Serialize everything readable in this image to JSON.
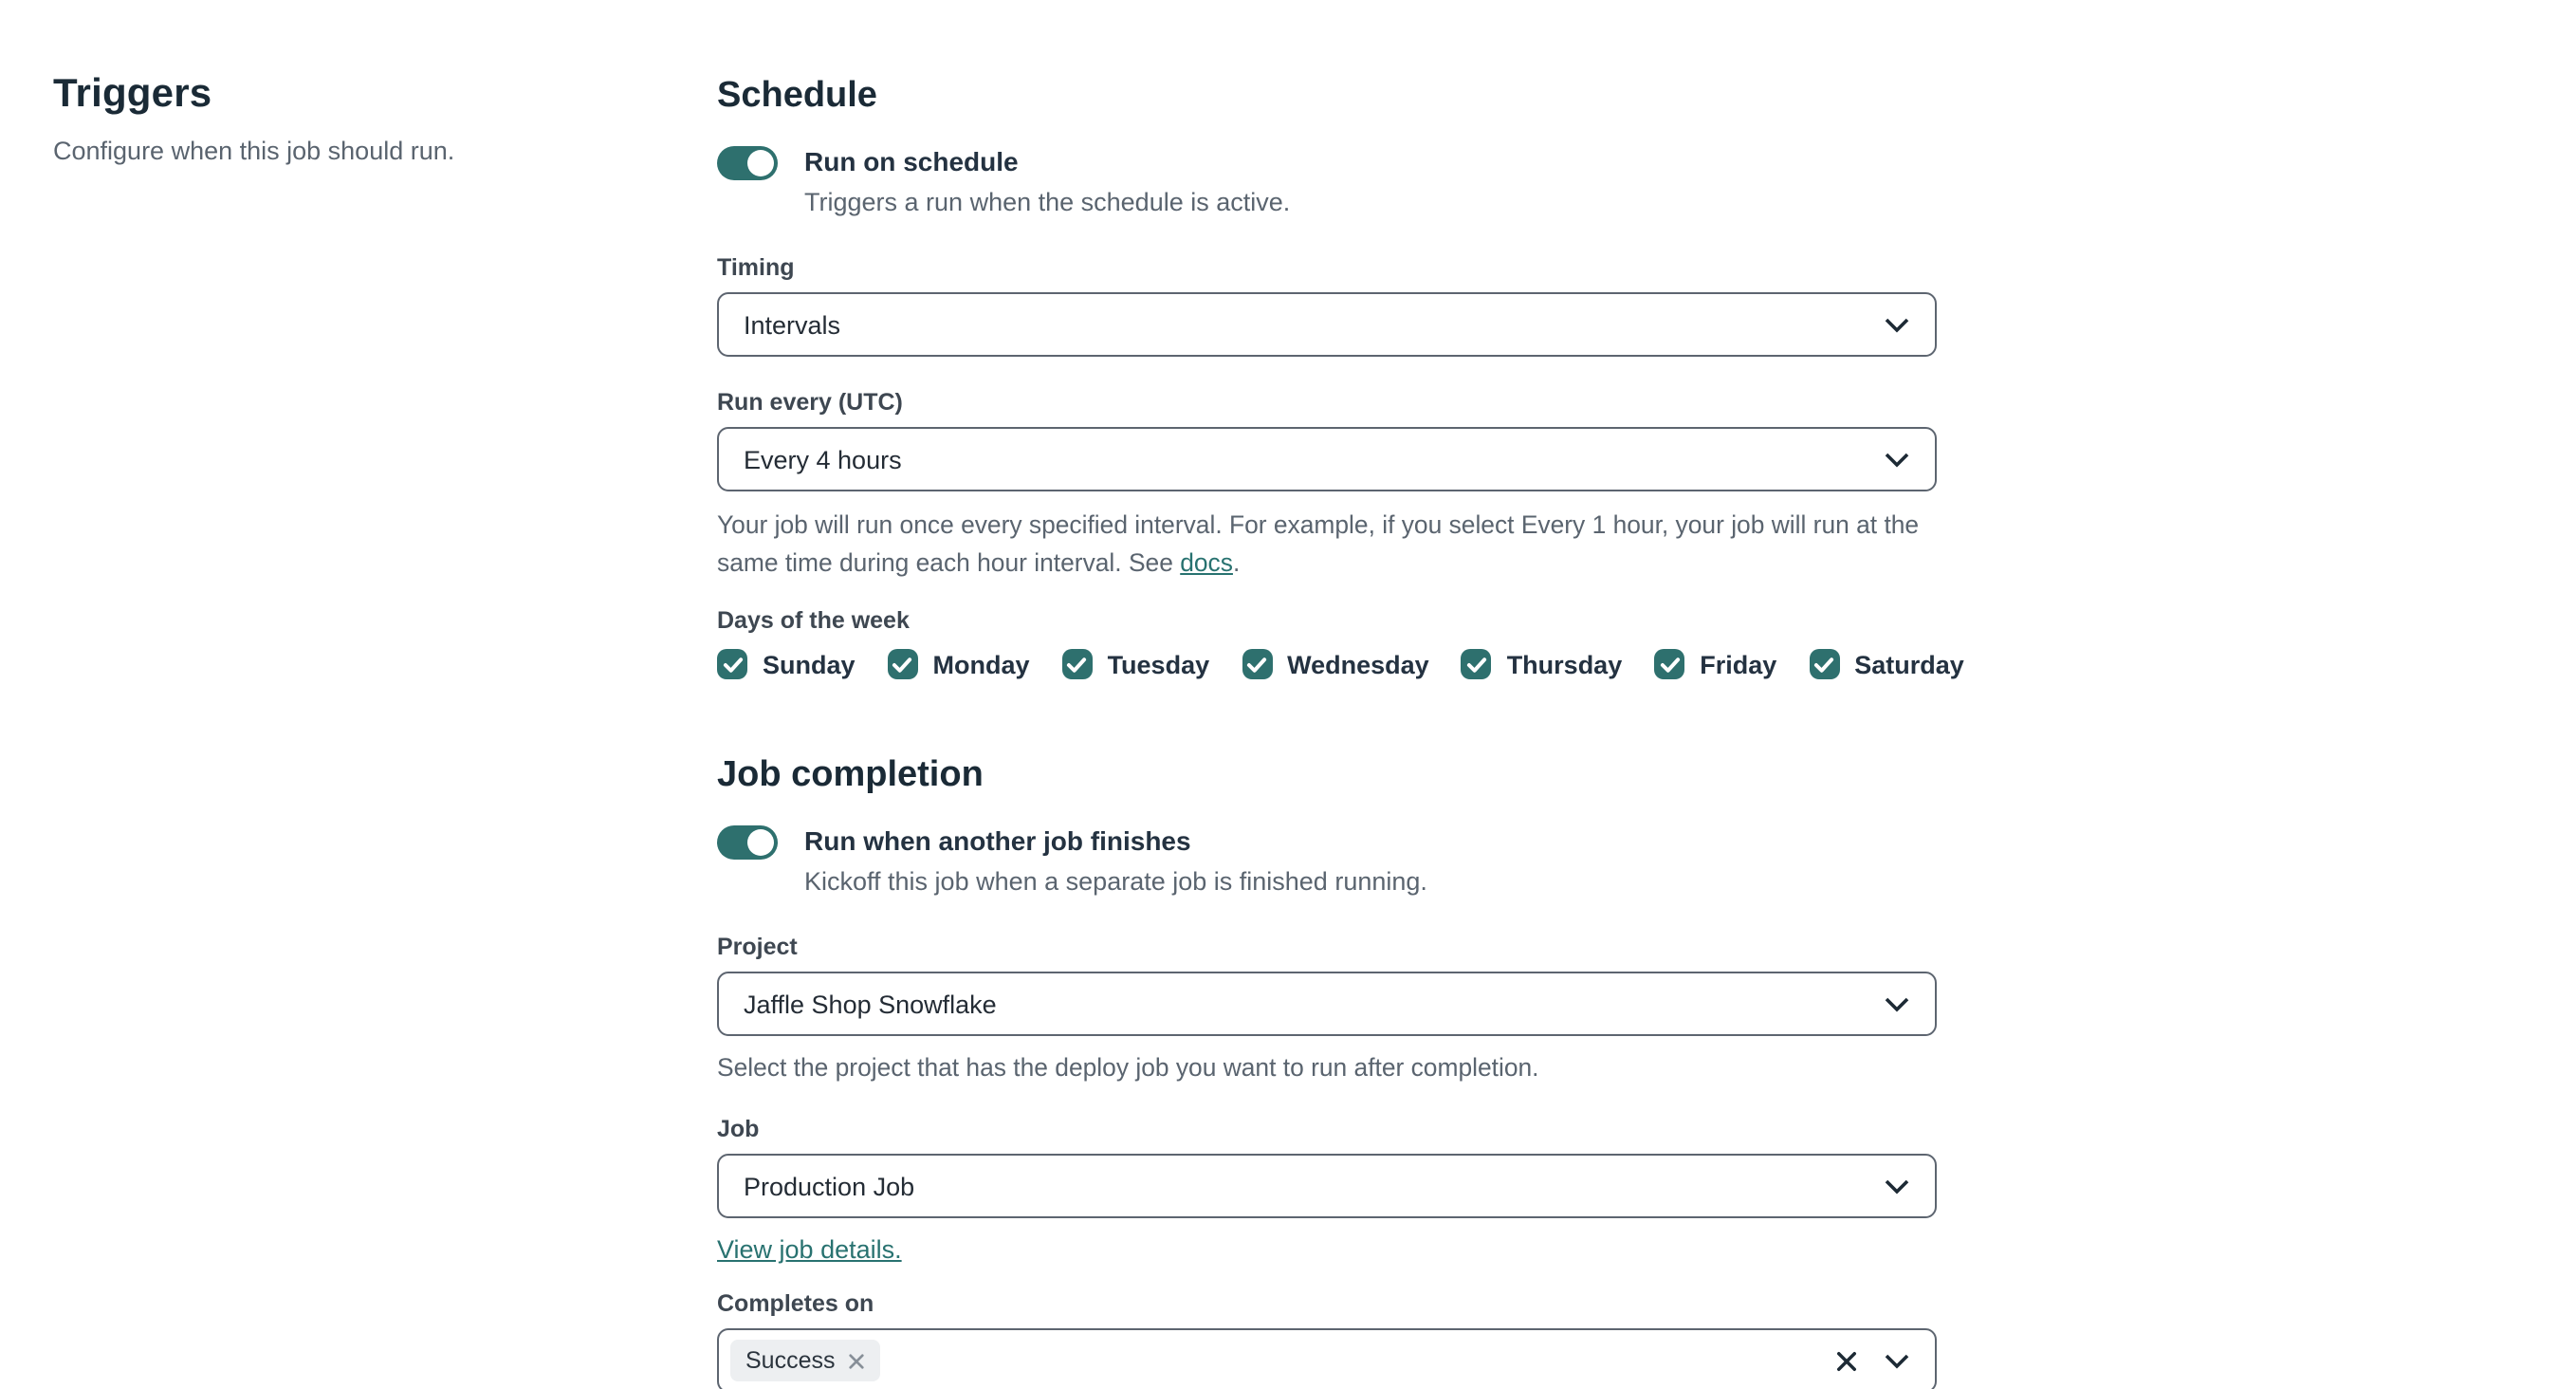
{
  "header": {
    "title": "Triggers",
    "subtitle": "Configure when this job should run."
  },
  "schedule": {
    "heading": "Schedule",
    "toggle": {
      "label": "Run on schedule",
      "description": "Triggers a run when the schedule is active.",
      "state": "on"
    },
    "timing": {
      "label": "Timing",
      "value": "Intervals"
    },
    "run_every": {
      "label": "Run every (UTC)",
      "value": "Every 4 hours",
      "help_text": "Your job will run once every specified interval. For example, if you select Every 1 hour, your job will run at the same time during each hour interval. See ",
      "help_link": "docs",
      "help_end": "."
    },
    "days": {
      "label": "Days of the week",
      "items": [
        {
          "label": "Sunday",
          "checked": true
        },
        {
          "label": "Monday",
          "checked": true
        },
        {
          "label": "Tuesday",
          "checked": true
        },
        {
          "label": "Wednesday",
          "checked": true
        },
        {
          "label": "Thursday",
          "checked": true
        },
        {
          "label": "Friday",
          "checked": true
        },
        {
          "label": "Saturday",
          "checked": true
        }
      ]
    }
  },
  "job_completion": {
    "heading": "Job completion",
    "toggle": {
      "label": "Run when another job finishes",
      "description": "Kickoff this job when a separate job is finished running.",
      "state": "on"
    },
    "project": {
      "label": "Project",
      "value": "Jaffle Shop Snowflake",
      "help": "Select the project that has the deploy job you want to run after completion."
    },
    "job": {
      "label": "Job",
      "value": "Production Job",
      "details_link": "View job details."
    },
    "completes_on": {
      "label": "Completes on",
      "selected": [
        {
          "label": "Success"
        }
      ]
    }
  },
  "colors": {
    "accent_teal": "#2e706e",
    "link_teal": "#287270",
    "heading_text": "#1a2a36",
    "muted_text": "#5a646f",
    "input_border": "#5d6570",
    "tag_background": "#edeff1"
  }
}
